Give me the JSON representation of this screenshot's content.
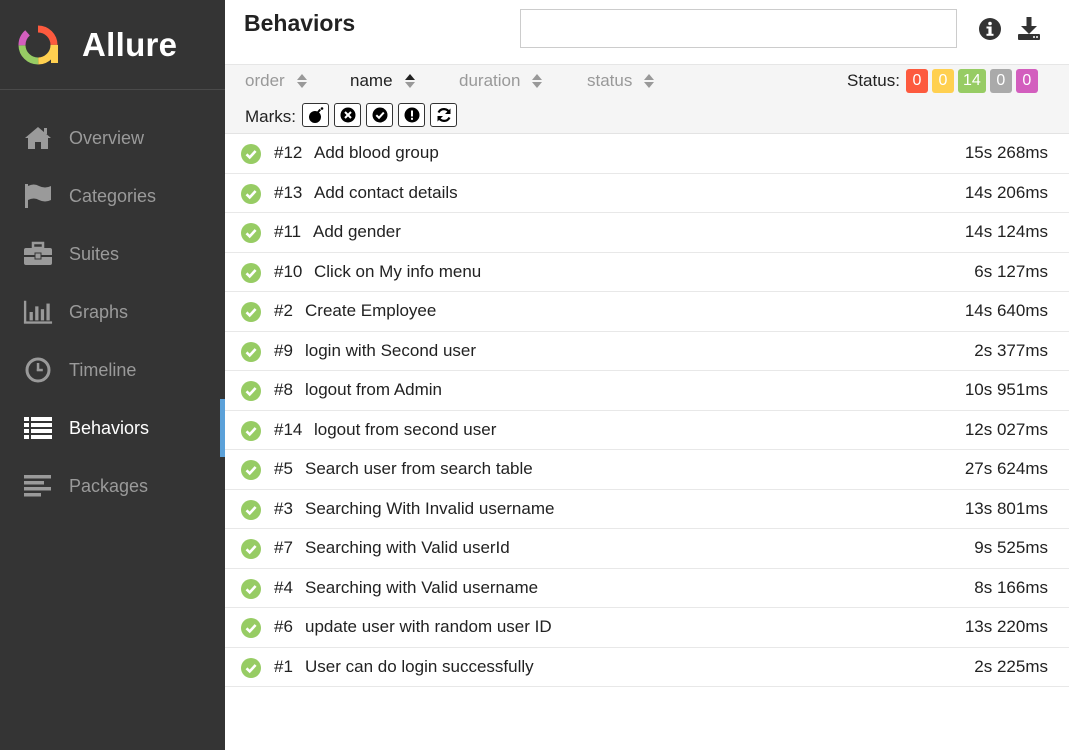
{
  "app": {
    "name": "Allure"
  },
  "sidebar": {
    "items": [
      {
        "label": "Overview",
        "icon": "home-icon",
        "active": false
      },
      {
        "label": "Categories",
        "icon": "flag-icon",
        "active": false
      },
      {
        "label": "Suites",
        "icon": "briefcase-icon",
        "active": false
      },
      {
        "label": "Graphs",
        "icon": "bar-chart-icon",
        "active": false
      },
      {
        "label": "Timeline",
        "icon": "clock-icon",
        "active": false
      },
      {
        "label": "Behaviors",
        "icon": "list-icon",
        "active": true
      },
      {
        "label": "Packages",
        "icon": "align-left-icon",
        "active": false
      }
    ]
  },
  "header": {
    "title": "Behaviors",
    "search_value": "",
    "info_icon": "info-icon",
    "download_icon": "download-icon"
  },
  "toolbar": {
    "sort": [
      {
        "label": "order",
        "active": false
      },
      {
        "label": "name",
        "active": true
      },
      {
        "label": "duration",
        "active": false
      },
      {
        "label": "status",
        "active": false
      }
    ],
    "status_label": "Status:",
    "status_badges": [
      {
        "value": "0",
        "status": "failed",
        "color": "#fd5a3e"
      },
      {
        "value": "0",
        "status": "broken",
        "color": "#ffd050"
      },
      {
        "value": "14",
        "status": "passed",
        "color": "#97cc64"
      },
      {
        "value": "0",
        "status": "skipped",
        "color": "#aaaaaa"
      },
      {
        "value": "0",
        "status": "unknown",
        "color": "#d35ebe"
      }
    ],
    "marks_label": "Marks:",
    "marks": [
      "bomb-icon",
      "times-circle-icon",
      "check-circle-icon",
      "exclamation-circle-icon",
      "refresh-icon"
    ]
  },
  "tests": [
    {
      "order": "#12",
      "name": "Add blood group",
      "duration": "15s 268ms"
    },
    {
      "order": "#13",
      "name": "Add contact details",
      "duration": "14s 206ms"
    },
    {
      "order": "#11",
      "name": "Add gender",
      "duration": "14s 124ms"
    },
    {
      "order": "#10",
      "name": "Click on My info menu",
      "duration": "6s 127ms"
    },
    {
      "order": "#2",
      "name": "Create Employee",
      "duration": "14s 640ms"
    },
    {
      "order": "#9",
      "name": "login with Second user",
      "duration": "2s 377ms"
    },
    {
      "order": "#8",
      "name": "logout from Admin",
      "duration": "10s 951ms"
    },
    {
      "order": "#14",
      "name": "logout from second user",
      "duration": "12s 027ms"
    },
    {
      "order": "#5",
      "name": "Search user from search table",
      "duration": "27s 624ms"
    },
    {
      "order": "#3",
      "name": "Searching With Invalid username",
      "duration": "13s 801ms"
    },
    {
      "order": "#7",
      "name": "Searching with Valid userId",
      "duration": "9s 525ms"
    },
    {
      "order": "#4",
      "name": "Searching with Valid username",
      "duration": "8s 166ms"
    },
    {
      "order": "#6",
      "name": "update user with random user ID",
      "duration": "13s 220ms"
    },
    {
      "order": "#1",
      "name": "User can do login successfully",
      "duration": "2s 225ms"
    }
  ],
  "colors": {
    "passed": "#97cc64",
    "sidebar_bg": "#343434",
    "active_accent": "#5ba1d9"
  }
}
